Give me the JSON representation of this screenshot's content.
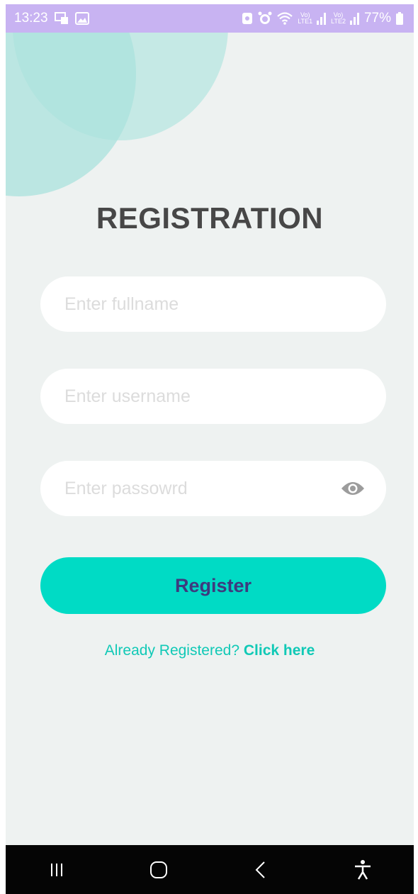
{
  "status_bar": {
    "time": "13:23",
    "net1": "Vo)\nLTE1",
    "net2": "Vo)\nLTE2",
    "battery": "77%"
  },
  "page": {
    "title": "REGISTRATION"
  },
  "form": {
    "fullname_placeholder": "Enter fullname",
    "username_placeholder": "Enter username",
    "password_placeholder": "Enter passowrd",
    "register_label": "Register",
    "login_prompt": "Already Registered?",
    "login_link": "Click here"
  },
  "icons": {
    "status_left": [
      "cast-icon",
      "image-icon"
    ],
    "status_right": [
      "battery-saver-icon",
      "alarm-icon",
      "wifi-icon",
      "signal-icon",
      "battery-icon"
    ],
    "password_toggle": "eye-icon",
    "nav": [
      "recents-icon",
      "home-icon",
      "back-icon",
      "accessibility-icon"
    ]
  },
  "colors": {
    "status_bar": "#c8b3f2",
    "background": "#eef2f1",
    "accent": "#00dbc5",
    "button_text": "#3e3a7e",
    "title": "#474747",
    "link": "#10c9b6"
  }
}
